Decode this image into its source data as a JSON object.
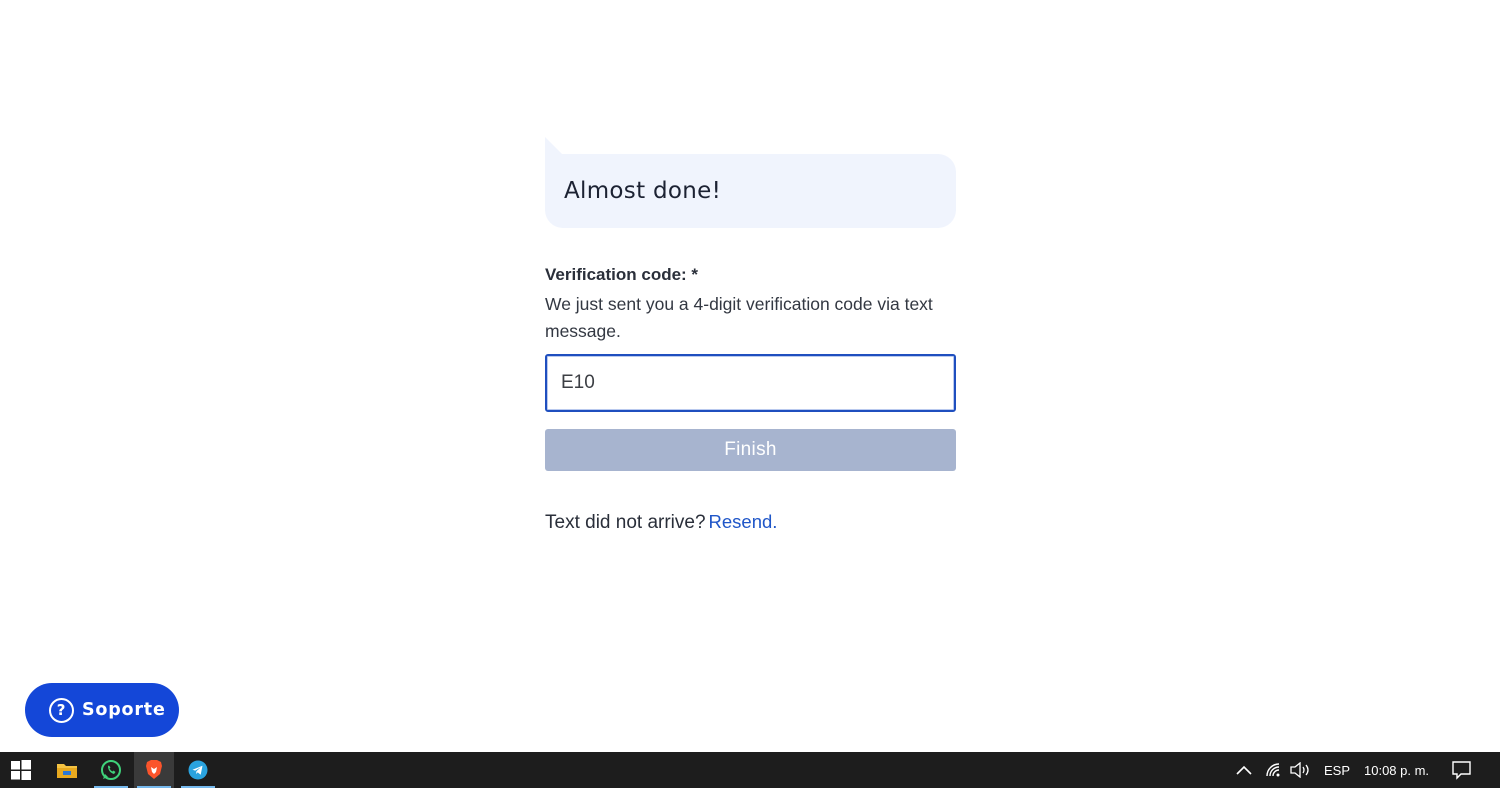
{
  "bubble": {
    "title": "Almost done!"
  },
  "form": {
    "label": "Verification code: *",
    "help": "We just sent you a 4-digit verification code via text message.",
    "code_value": "E10",
    "finish_label": "Finish",
    "resend_prompt": "Text did not arrive?",
    "resend_link": "Resend."
  },
  "support": {
    "label": "Soporte",
    "icon": "help-circle-icon"
  },
  "taskbar": {
    "apps": [
      {
        "name": "windows-start",
        "icon": "windows-logo-icon"
      },
      {
        "name": "file-explorer",
        "icon": "folder-icon"
      },
      {
        "name": "whatsapp",
        "icon": "whatsapp-icon"
      },
      {
        "name": "brave",
        "icon": "brave-lion-icon"
      },
      {
        "name": "telegram",
        "icon": "telegram-icon"
      }
    ],
    "language": "ESP",
    "time": "10:08 p. m."
  },
  "colors": {
    "accent": "#1447d8",
    "input_border": "#1f4fbf",
    "button_disabled": "#a7b4cf",
    "bubble_bg": "#f0f4fd",
    "link": "#1f56c8"
  }
}
